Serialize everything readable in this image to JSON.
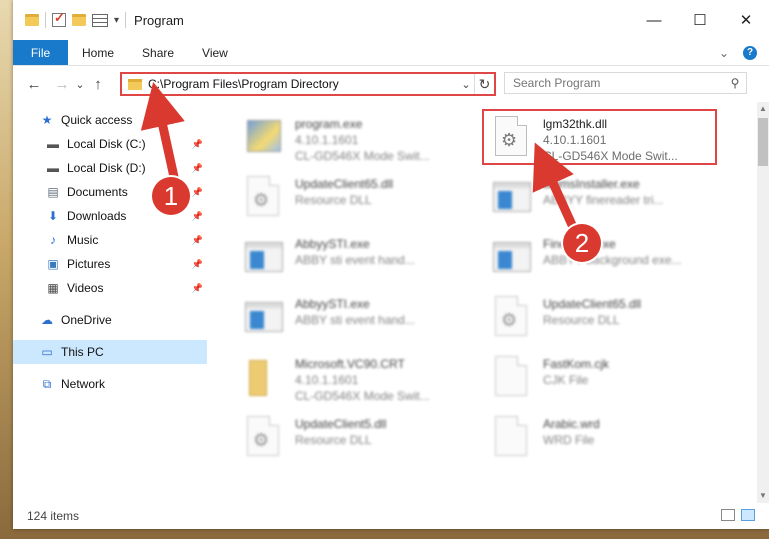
{
  "window": {
    "title": "Program",
    "minimize_glyph": "—",
    "maximize_glyph": "☐",
    "close_glyph": "✕"
  },
  "ribbon": {
    "file_label": "File",
    "tabs": [
      "Home",
      "Share",
      "View"
    ],
    "expand_glyph": "⌄",
    "help_glyph": "?"
  },
  "navigation": {
    "back_glyph": "←",
    "forward_glyph": "→",
    "recent_glyph": "⌄",
    "up_glyph": "↑"
  },
  "address": {
    "path": "C:\\Program Files\\Program Directory",
    "dropdown_glyph": "⌄",
    "refresh_glyph": "↻"
  },
  "search": {
    "placeholder": "Search Program",
    "icon_glyph": "⚲"
  },
  "sidebar": {
    "items": [
      {
        "label": "Quick access",
        "icon": "star-icon",
        "glyph": "★",
        "color": "#2b6fcf"
      },
      {
        "label": "Local Disk (C:)",
        "icon": "drive-icon",
        "glyph": "▬",
        "color": "#555555",
        "pinned": true
      },
      {
        "label": "Local Disk (D:)",
        "icon": "drive-icon",
        "glyph": "▬",
        "color": "#555555",
        "pinned": true
      },
      {
        "label": "Documents",
        "icon": "documents-icon",
        "glyph": "▤",
        "color": "#5f6b7a",
        "pinned": true
      },
      {
        "label": "Downloads",
        "icon": "download-icon",
        "glyph": "⬇",
        "color": "#2b6fcf",
        "pinned": true
      },
      {
        "label": "Music",
        "icon": "music-icon",
        "glyph": "♪",
        "color": "#2b6fcf",
        "pinned": true
      },
      {
        "label": "Pictures",
        "icon": "pictures-icon",
        "glyph": "▣",
        "color": "#3a7bbf",
        "pinned": true
      },
      {
        "label": "Videos",
        "icon": "videos-icon",
        "glyph": "▦",
        "color": "#444444",
        "pinned": true
      },
      {
        "label": "OneDrive",
        "icon": "cloud-icon",
        "glyph": "☁",
        "color": "#2b6fcf"
      },
      {
        "label": "This PC",
        "icon": "computer-icon",
        "glyph": "▭",
        "color": "#2b6fcf",
        "selected": true
      },
      {
        "label": "Network",
        "icon": "network-icon",
        "glyph": "⧉",
        "color": "#2b6fcf"
      }
    ],
    "pin_glyph": "📌"
  },
  "files": [
    {
      "name": "program.exe",
      "line2": "4.10.1.1601",
      "line3": "CL-GD546X Mode Swit...",
      "kind": "exe",
      "blur": true
    },
    {
      "name": "lgm32thk.dll",
      "line2": "4.10.1.1601",
      "line3": "CL-GD546X Mode Swit...",
      "kind": "dll",
      "blur": false
    },
    {
      "name": "UpdateClient65.dll",
      "line2": "Resource DLL",
      "line3": "",
      "kind": "dll",
      "blur": true
    },
    {
      "name": "ammsInstaller.exe",
      "line2": "ABBYY finereader tri...",
      "line3": "",
      "kind": "win",
      "blur": true
    },
    {
      "name": "AbbyySTI.exe",
      "line2": "ABBY sti event hand...",
      "line3": "",
      "kind": "win",
      "blur": true
    },
    {
      "name": "FineExec.exe",
      "line2": "ABBYY background exe...",
      "line3": "",
      "kind": "win",
      "blur": true
    },
    {
      "name": "AbbyySTI.exe",
      "line2": "ABBY sti event hand...",
      "line3": "",
      "kind": "win",
      "blur": true
    },
    {
      "name": "UpdateClient65.dll",
      "line2": "Resource DLL",
      "line3": "",
      "kind": "dll",
      "blur": true
    },
    {
      "name": "Microsoft.VC90.CRT",
      "line2": "4.10.1.1601",
      "line3": "CL-GD546X Mode Swit...",
      "kind": "folder",
      "blur": true
    },
    {
      "name": "FastKom.cjk",
      "line2": "CJK File",
      "line3": "",
      "kind": "doc",
      "blur": true
    },
    {
      "name": "UpdateClient5.dll",
      "line2": "Resource DLL",
      "line3": "",
      "kind": "dll",
      "blur": true
    },
    {
      "name": "Arabic.wrd",
      "line2": "WRD File",
      "line3": "",
      "kind": "doc",
      "blur": true
    }
  ],
  "markers": {
    "one": "1",
    "two": "2"
  },
  "status": {
    "item_count": "124 items"
  },
  "colors": {
    "accent": "#1979ca",
    "highlight": "#e04646",
    "selection": "#cce8ff",
    "marker": "#d9392f"
  }
}
